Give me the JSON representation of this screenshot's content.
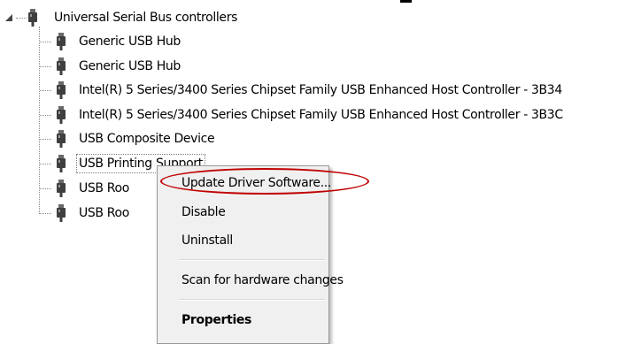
{
  "tree": {
    "root": {
      "label": "Universal Serial Bus controllers",
      "expanded": true,
      "icon": "usb-plug-icon"
    },
    "children": [
      {
        "label": "Generic USB Hub",
        "icon": "usb-plug-icon",
        "selected": false
      },
      {
        "label": "Generic USB Hub",
        "icon": "usb-plug-icon",
        "selected": false
      },
      {
        "label": "Intel(R) 5 Series/3400 Series Chipset Family USB Enhanced Host Controller - 3B34",
        "icon": "usb-plug-icon",
        "selected": false
      },
      {
        "label": "Intel(R) 5 Series/3400 Series Chipset Family USB Enhanced Host Controller - 3B3C",
        "icon": "usb-plug-icon",
        "selected": false
      },
      {
        "label": "USB Composite Device",
        "icon": "usb-plug-icon",
        "selected": false
      },
      {
        "label": "USB Printing Support",
        "icon": "usb-plug-icon",
        "selected": true
      },
      {
        "label": "USB Roo",
        "icon": "usb-plug-icon",
        "selected": false
      },
      {
        "label": "USB Roo",
        "icon": "usb-plug-icon",
        "selected": false
      }
    ]
  },
  "context_menu": {
    "items": [
      {
        "label": "Update Driver Software...",
        "bold": false,
        "highlighted_by_annotation": true
      },
      {
        "label": "Disable",
        "bold": false
      },
      {
        "label": "Uninstall",
        "bold": false
      },
      {
        "separator": true
      },
      {
        "label": "Scan for hardware changes",
        "bold": false
      },
      {
        "separator": true
      },
      {
        "label": "Properties",
        "bold": true
      }
    ]
  },
  "colors": {
    "annotation_ellipse": "#c00000",
    "menu_background": "#f0f0f0",
    "tree_connector": "#8a8a8a"
  }
}
